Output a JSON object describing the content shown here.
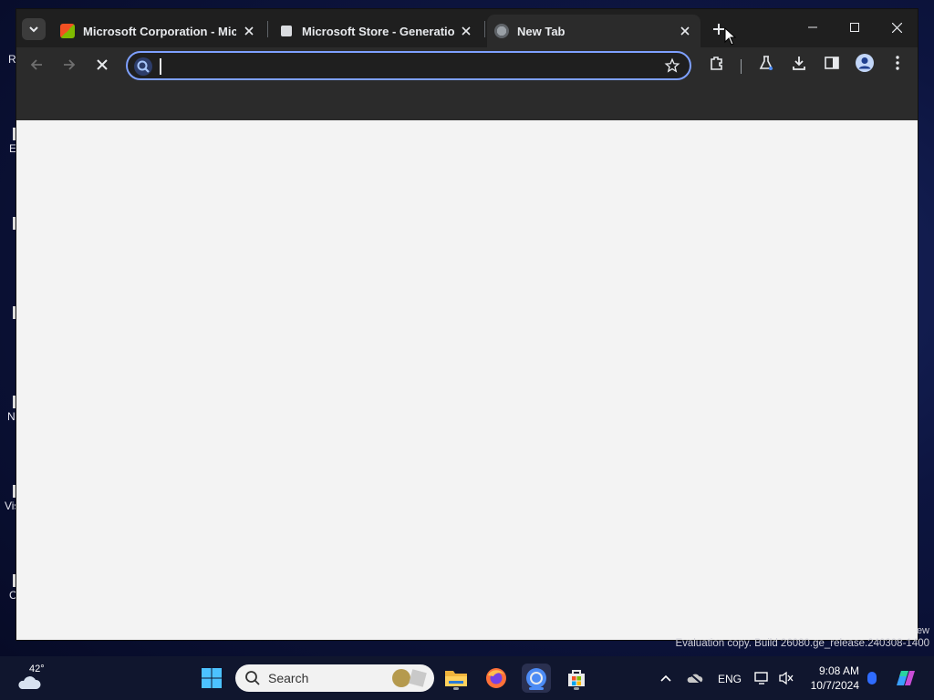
{
  "desktop": {
    "fragments": [
      "R",
      "E",
      "N",
      "Vis",
      "C"
    ],
    "watermark_tail": "ew",
    "watermark": "Evaluation copy. Build 26080.ge_release.240308-1400"
  },
  "browser": {
    "tabs": [
      {
        "title": "Microsoft Corporation - Micro",
        "icon": "microsoft-store-favicon",
        "active": false
      },
      {
        "title": "Microsoft Store - Generation P",
        "icon": "bag-favicon",
        "active": false
      },
      {
        "title": "New Tab",
        "icon": "globe-favicon",
        "active": true
      }
    ],
    "omnibox": {
      "value": "",
      "placeholder": ""
    },
    "icons": {
      "back": "arrow-left-icon",
      "forward": "arrow-right-icon",
      "stop": "close-icon",
      "bookmark": "star-icon",
      "extensions": "puzzle-icon",
      "labs": "flask-icon",
      "downloads": "download-icon",
      "side_panel": "side-panel-icon",
      "profile": "profile-icon",
      "menu": "kebab-menu-icon"
    },
    "colors": {
      "frame": "#1f1f1f",
      "toolbar": "#2b2b2b",
      "focus_ring": "#7ea0ff",
      "content": "#f3f3f3"
    }
  },
  "taskbar": {
    "weather_temp": "42°",
    "search_label": "Search",
    "language": "ENG",
    "time": "9:08 AM",
    "date": "10/7/2024",
    "apps": [
      "start",
      "search",
      "file-explorer",
      "firefox",
      "chrome",
      "microsoft-store"
    ]
  }
}
